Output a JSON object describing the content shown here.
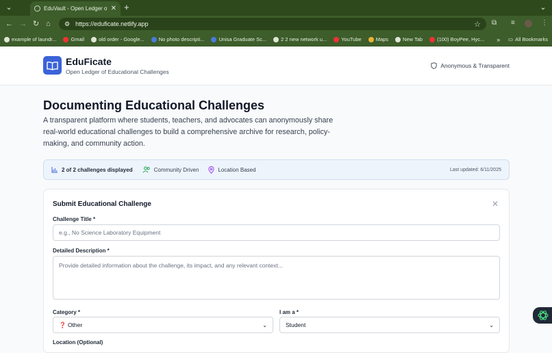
{
  "browser": {
    "tab_title": "EduVault - Open Ledger of Ed",
    "url": "https://eduficate.netlify.app",
    "bookmarks": [
      {
        "label": "example of laundr...",
        "icon": "google-icon"
      },
      {
        "label": "Gmail",
        "icon": "gmail-icon"
      },
      {
        "label": "old order - Google...",
        "icon": "google-icon"
      },
      {
        "label": "No photo descripti...",
        "icon": "facebook-icon"
      },
      {
        "label": "Unisa Graduate Sc...",
        "icon": "facebook-icon"
      },
      {
        "label": "2 2 new network u...",
        "icon": "globe-icon"
      },
      {
        "label": "YouTube",
        "icon": "youtube-icon"
      },
      {
        "label": "Maps",
        "icon": "maps-icon"
      },
      {
        "label": "New Tab",
        "icon": "globe-icon"
      },
      {
        "label": "(100) BoyPee, Hyc...",
        "icon": "youtube-icon"
      }
    ],
    "more_label": "»",
    "all_bookmarks": "All Bookmarks"
  },
  "header": {
    "brand": "EduFicate",
    "tagline": "Open Ledger of Educational Challenges",
    "badge": "Anonymous & Transparent"
  },
  "hero": {
    "title": "Documenting Educational Challenges",
    "description": "A transparent platform where students, teachers, and advocates can anonymously share real-world educational challenges to build a comprehensive archive for research, policy-making, and community action."
  },
  "stats": {
    "count": "2 of 2 challenges displayed",
    "community": "Community Driven",
    "location": "Location Based",
    "updated": "Last updated: 6/11/2025"
  },
  "form": {
    "title": "Submit Educational Challenge",
    "title_label": "Challenge Title *",
    "title_placeholder": "e.g., No Science Laboratory Equipment",
    "desc_label": "Detailed Description *",
    "desc_placeholder": "Provide detailed information about the challenge, its impact, and any relevant context...",
    "category_label": "Category *",
    "category_value": "❓ Other",
    "role_label": "I am a *",
    "role_value": "Student",
    "location_label": "Location (Optional)"
  },
  "colors": {
    "brand": "#3b63d8",
    "chrome": "#2e4a1c"
  }
}
